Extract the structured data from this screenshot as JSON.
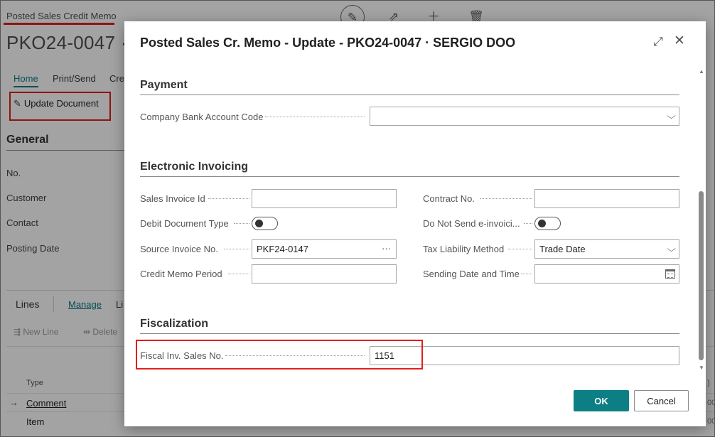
{
  "background": {
    "caption": "Posted Sales Credit Memo",
    "title": "PKO24-0047 ·",
    "tabs": [
      "Home",
      "Print/Send",
      "Cre"
    ],
    "update_document_label": "Update Document",
    "general_title": "General",
    "fields": [
      "No.",
      "Customer",
      "Contact",
      "Posting Date"
    ],
    "lines": {
      "title": "Lines",
      "manage": "Manage",
      "manage_fragment": "Li",
      "new_line": "New Line",
      "delete_fragment": "Delete",
      "type_header": "Type",
      "rows": [
        "Comment",
        "Item"
      ],
      "right_fragments": [
        ")",
        "00",
        "00"
      ]
    }
  },
  "dialog": {
    "title": "Posted Sales Cr. Memo - Update - PKO24-0047 · SERGIO DOO",
    "sections": {
      "payment": {
        "title": "Payment",
        "company_bank_account_code_label": "Company Bank Account Code",
        "company_bank_account_code_value": ""
      },
      "einvoicing": {
        "title": "Electronic Invoicing",
        "sales_invoice_id_label": "Sales Invoice Id",
        "sales_invoice_id_value": "",
        "contract_no_label": "Contract No.",
        "contract_no_value": "",
        "debit_document_type_label": "Debit Document Type",
        "debit_document_type_value": false,
        "do_not_send_label": "Do Not Send e-invoici...",
        "do_not_send_value": false,
        "source_invoice_no_label": "Source Invoice No.",
        "source_invoice_no_value": "PKF24-0147",
        "tax_liability_method_label": "Tax Liability Method",
        "tax_liability_method_value": "Trade Date",
        "credit_memo_period_label": "Credit Memo Period",
        "credit_memo_period_value": "",
        "sending_date_time_label": "Sending Date and Time",
        "sending_date_time_value": ""
      },
      "fiscalization": {
        "title": "Fiscalization",
        "fiscal_inv_sales_no_label": "Fiscal Inv. Sales No.",
        "fiscal_inv_sales_no_value": "1151"
      }
    },
    "ok_label": "OK",
    "cancel_label": "Cancel"
  },
  "colors": {
    "accent": "#0b7f84",
    "highlight": "#e0201b",
    "overlay": "#000000"
  },
  "icons": {
    "edit": "pencil-icon",
    "share": "share-icon",
    "new": "plus-icon",
    "delete": "trash-icon",
    "expand": "expand-icon",
    "close": "close-icon",
    "dropdown": "chevron-down-icon",
    "lookup": "ellipsis-icon",
    "date": "calendar-icon"
  }
}
